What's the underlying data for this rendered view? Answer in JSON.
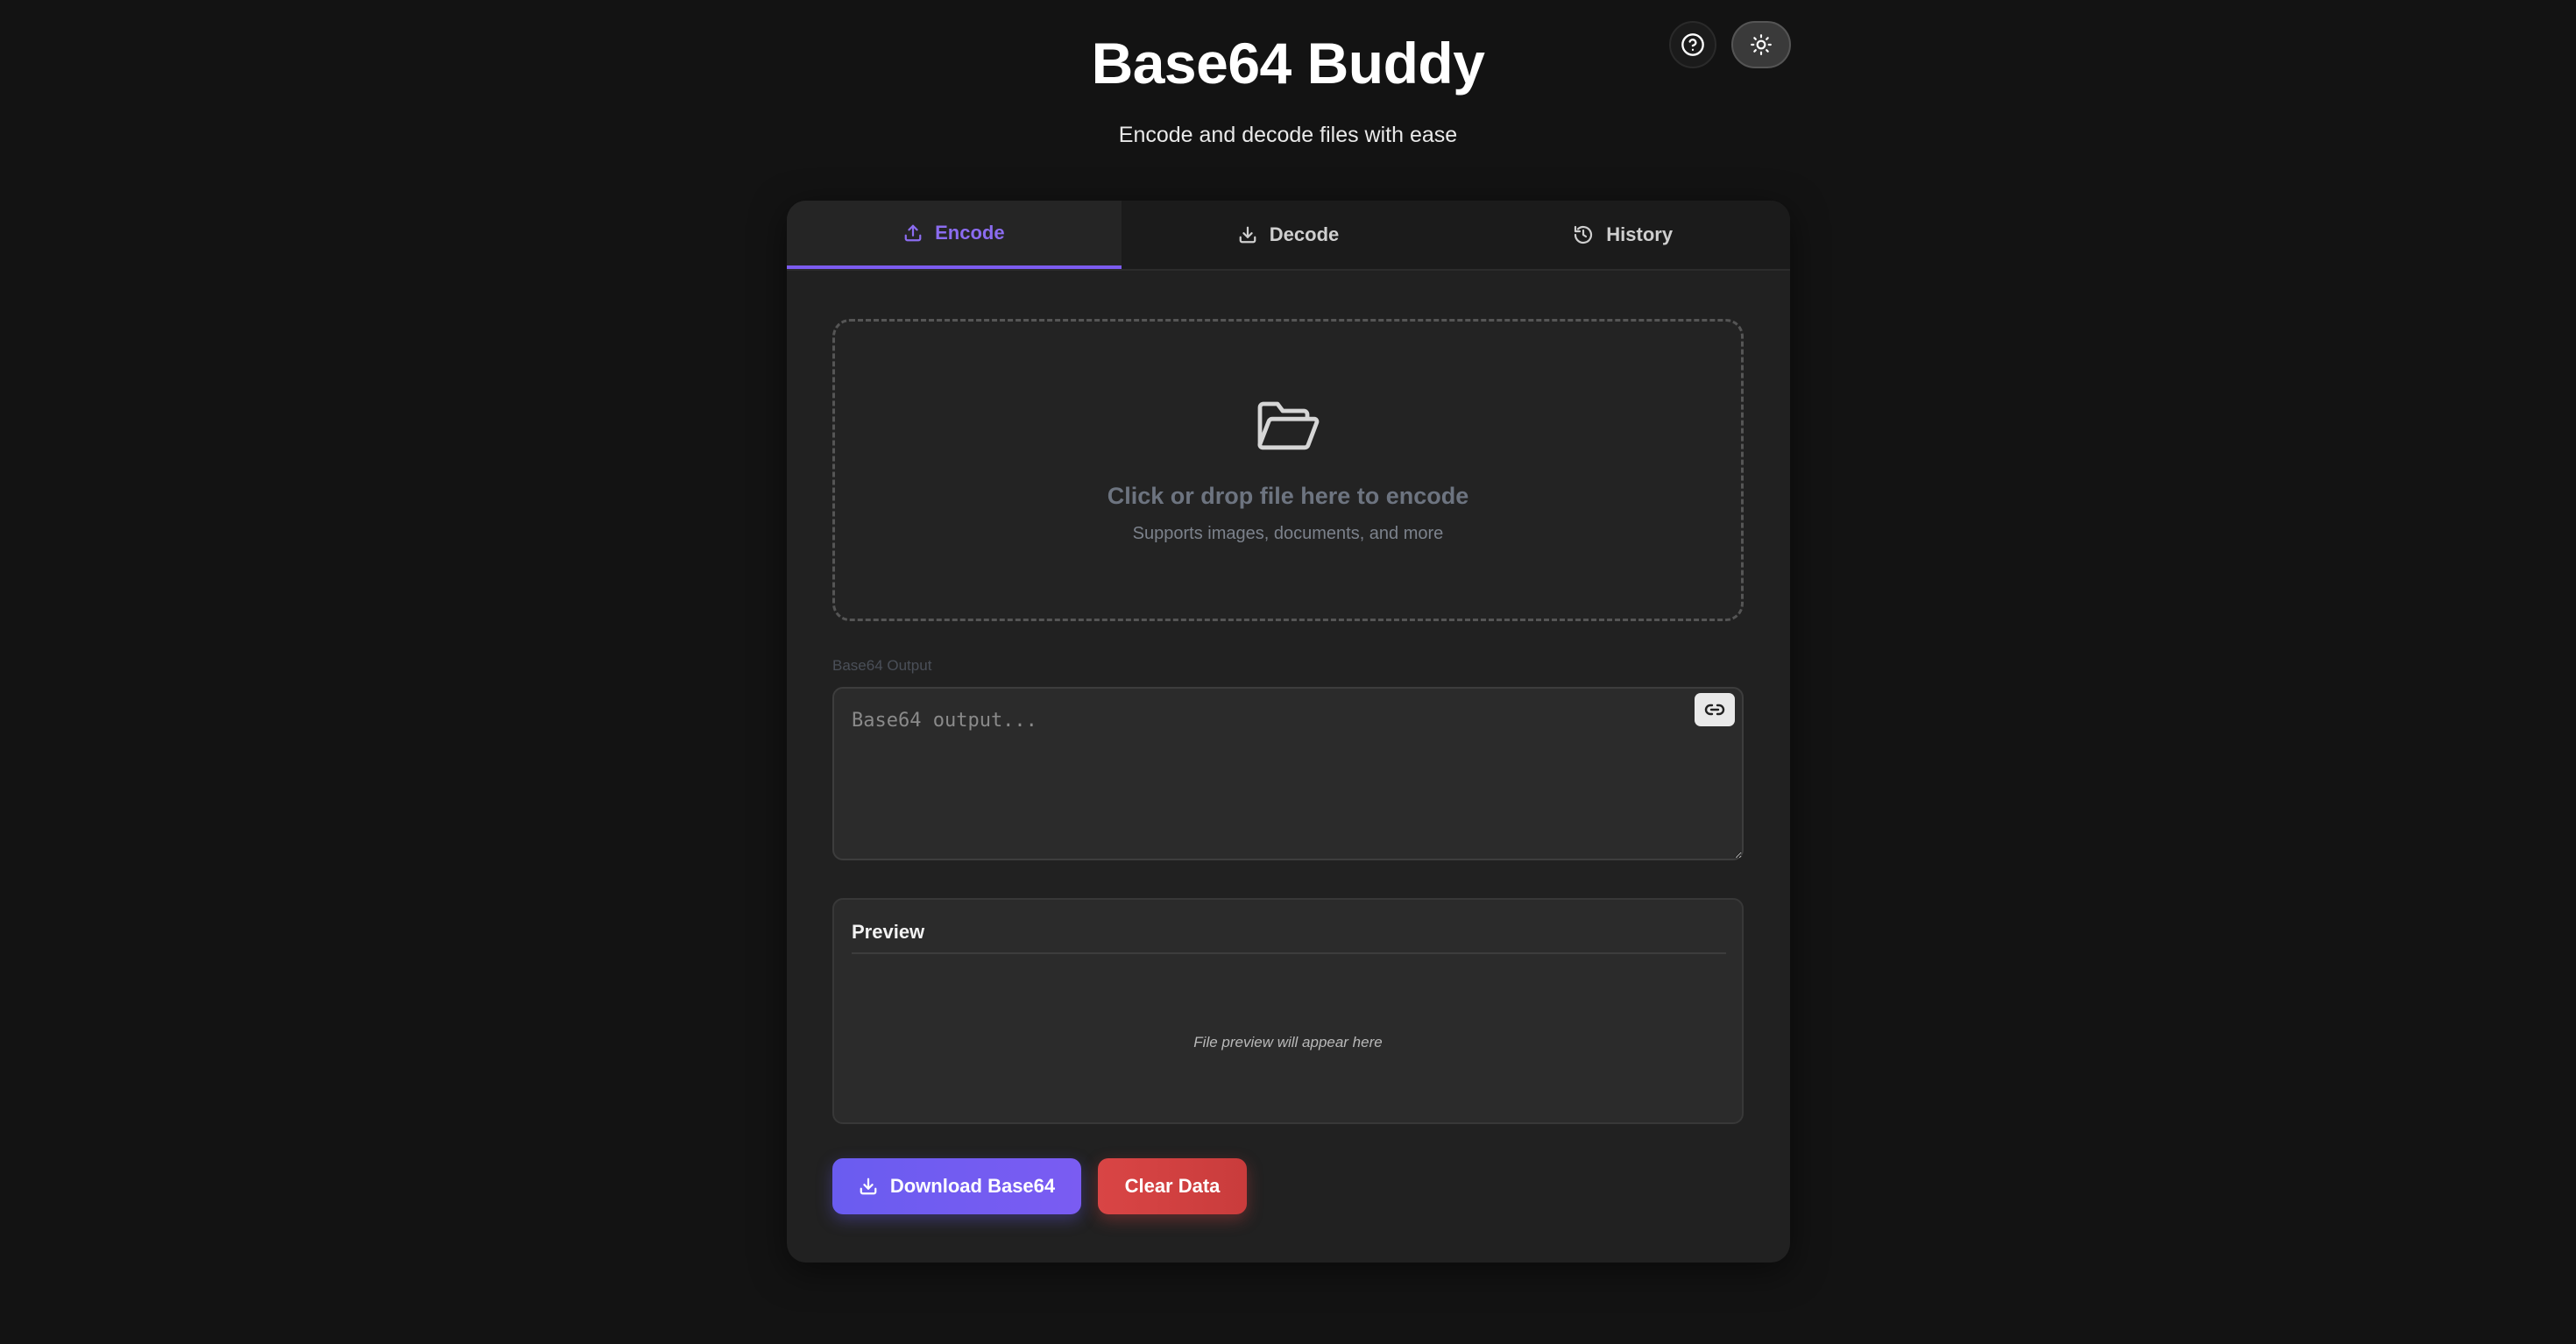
{
  "header": {
    "title": "Base64 Buddy",
    "subtitle": "Encode and decode files with ease",
    "help_icon": "question-circle-icon",
    "theme_icon": "sun-icon"
  },
  "tabs": [
    {
      "label": "Encode",
      "icon": "upload-icon",
      "active": true
    },
    {
      "label": "Decode",
      "icon": "download-icon",
      "active": false
    },
    {
      "label": "History",
      "icon": "history-icon",
      "active": false
    }
  ],
  "dropzone": {
    "icon": "folder-open-icon",
    "title": "Click or drop file here to encode",
    "subtitle": "Supports images, documents, and more"
  },
  "output": {
    "label": "Base64 Output",
    "placeholder": "Base64 output...",
    "value": "",
    "copy_icon": "link-icon"
  },
  "preview": {
    "title": "Preview",
    "empty_text": "File preview will appear here"
  },
  "actions": {
    "download_label": "Download Base64",
    "clear_label": "Clear Data"
  },
  "colors": {
    "background": "#131313",
    "card": "#212121",
    "accent": "#7c5cf0",
    "danger": "#d94545"
  }
}
